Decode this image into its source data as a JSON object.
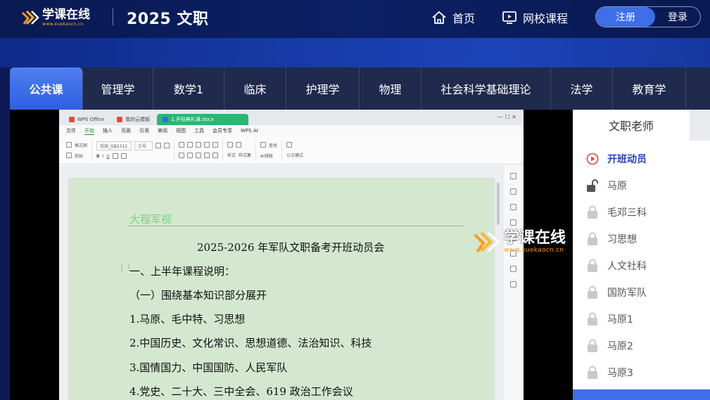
{
  "header": {
    "logo_cn": "学课在线",
    "logo_url": "www.xuekaocn.cn",
    "site_title": "2025 文职",
    "nav": [
      {
        "label": "首页",
        "icon": "home-icon"
      },
      {
        "label": "网校课程",
        "icon": "monitor-play-icon"
      }
    ],
    "register_label": "注册",
    "login_label": "登录"
  },
  "tabs": [
    "公共课",
    "管理学",
    "数学1",
    "临床",
    "护理学",
    "物理",
    "社会科学基础理论",
    "法学",
    "教育学"
  ],
  "active_tab": "公共课",
  "wps": {
    "tabs": [
      "WPS Office",
      "我的云模板",
      "1.开班典礼课.docx"
    ],
    "menu": [
      "文件",
      "开始",
      "插入",
      "页面",
      "引用",
      "审阅",
      "视图",
      "工具",
      "会员专享",
      "WPS AI"
    ],
    "menu_active": "开始",
    "ribbon": {
      "format_painter": "格式刷",
      "paste": "粘贴",
      "font": "仿宋_GB2312",
      "size": "三号",
      "style": "样式",
      "style_set": "样式集",
      "find": "查找",
      "ai_format": "AI排版",
      "official_mode": "公文模式"
    }
  },
  "document": {
    "header_text": "大程军视",
    "title": "2025-2026 年军队文职备考开班动员会",
    "lines": [
      "一、上半年课程说明：",
      "（一）围绕基本知识部分展开",
      "1.马原、毛中特、习思想",
      "2.中国历史、文化常识、思想道德、法治知识、科技",
      "3.国情国力、中国国防、人民军队",
      "4.党史、二十大、三中全会、619 政治工作会议"
    ]
  },
  "watermark": {
    "cn": "学课在线",
    "url": "www.xuekaocn.cn"
  },
  "sidebar": {
    "title": "文职老师",
    "lessons": [
      {
        "label": "开班动员",
        "state": "playing"
      },
      {
        "label": "马原",
        "state": "unlocked"
      },
      {
        "label": "毛邓三科",
        "state": "locked"
      },
      {
        "label": "习思想",
        "state": "locked"
      },
      {
        "label": "人文社科",
        "state": "locked"
      },
      {
        "label": "国防军队",
        "state": "locked"
      },
      {
        "label": "马原1",
        "state": "locked"
      },
      {
        "label": "马原2",
        "state": "locked"
      },
      {
        "label": "马原3",
        "state": "locked"
      }
    ]
  },
  "colors": {
    "accent": "#3e6ee8",
    "header_bg": "#0a1a52",
    "tab_bar": "#1f2a4c",
    "active_lesson": "#2a3fb4",
    "play_icon": "#e0463c"
  }
}
